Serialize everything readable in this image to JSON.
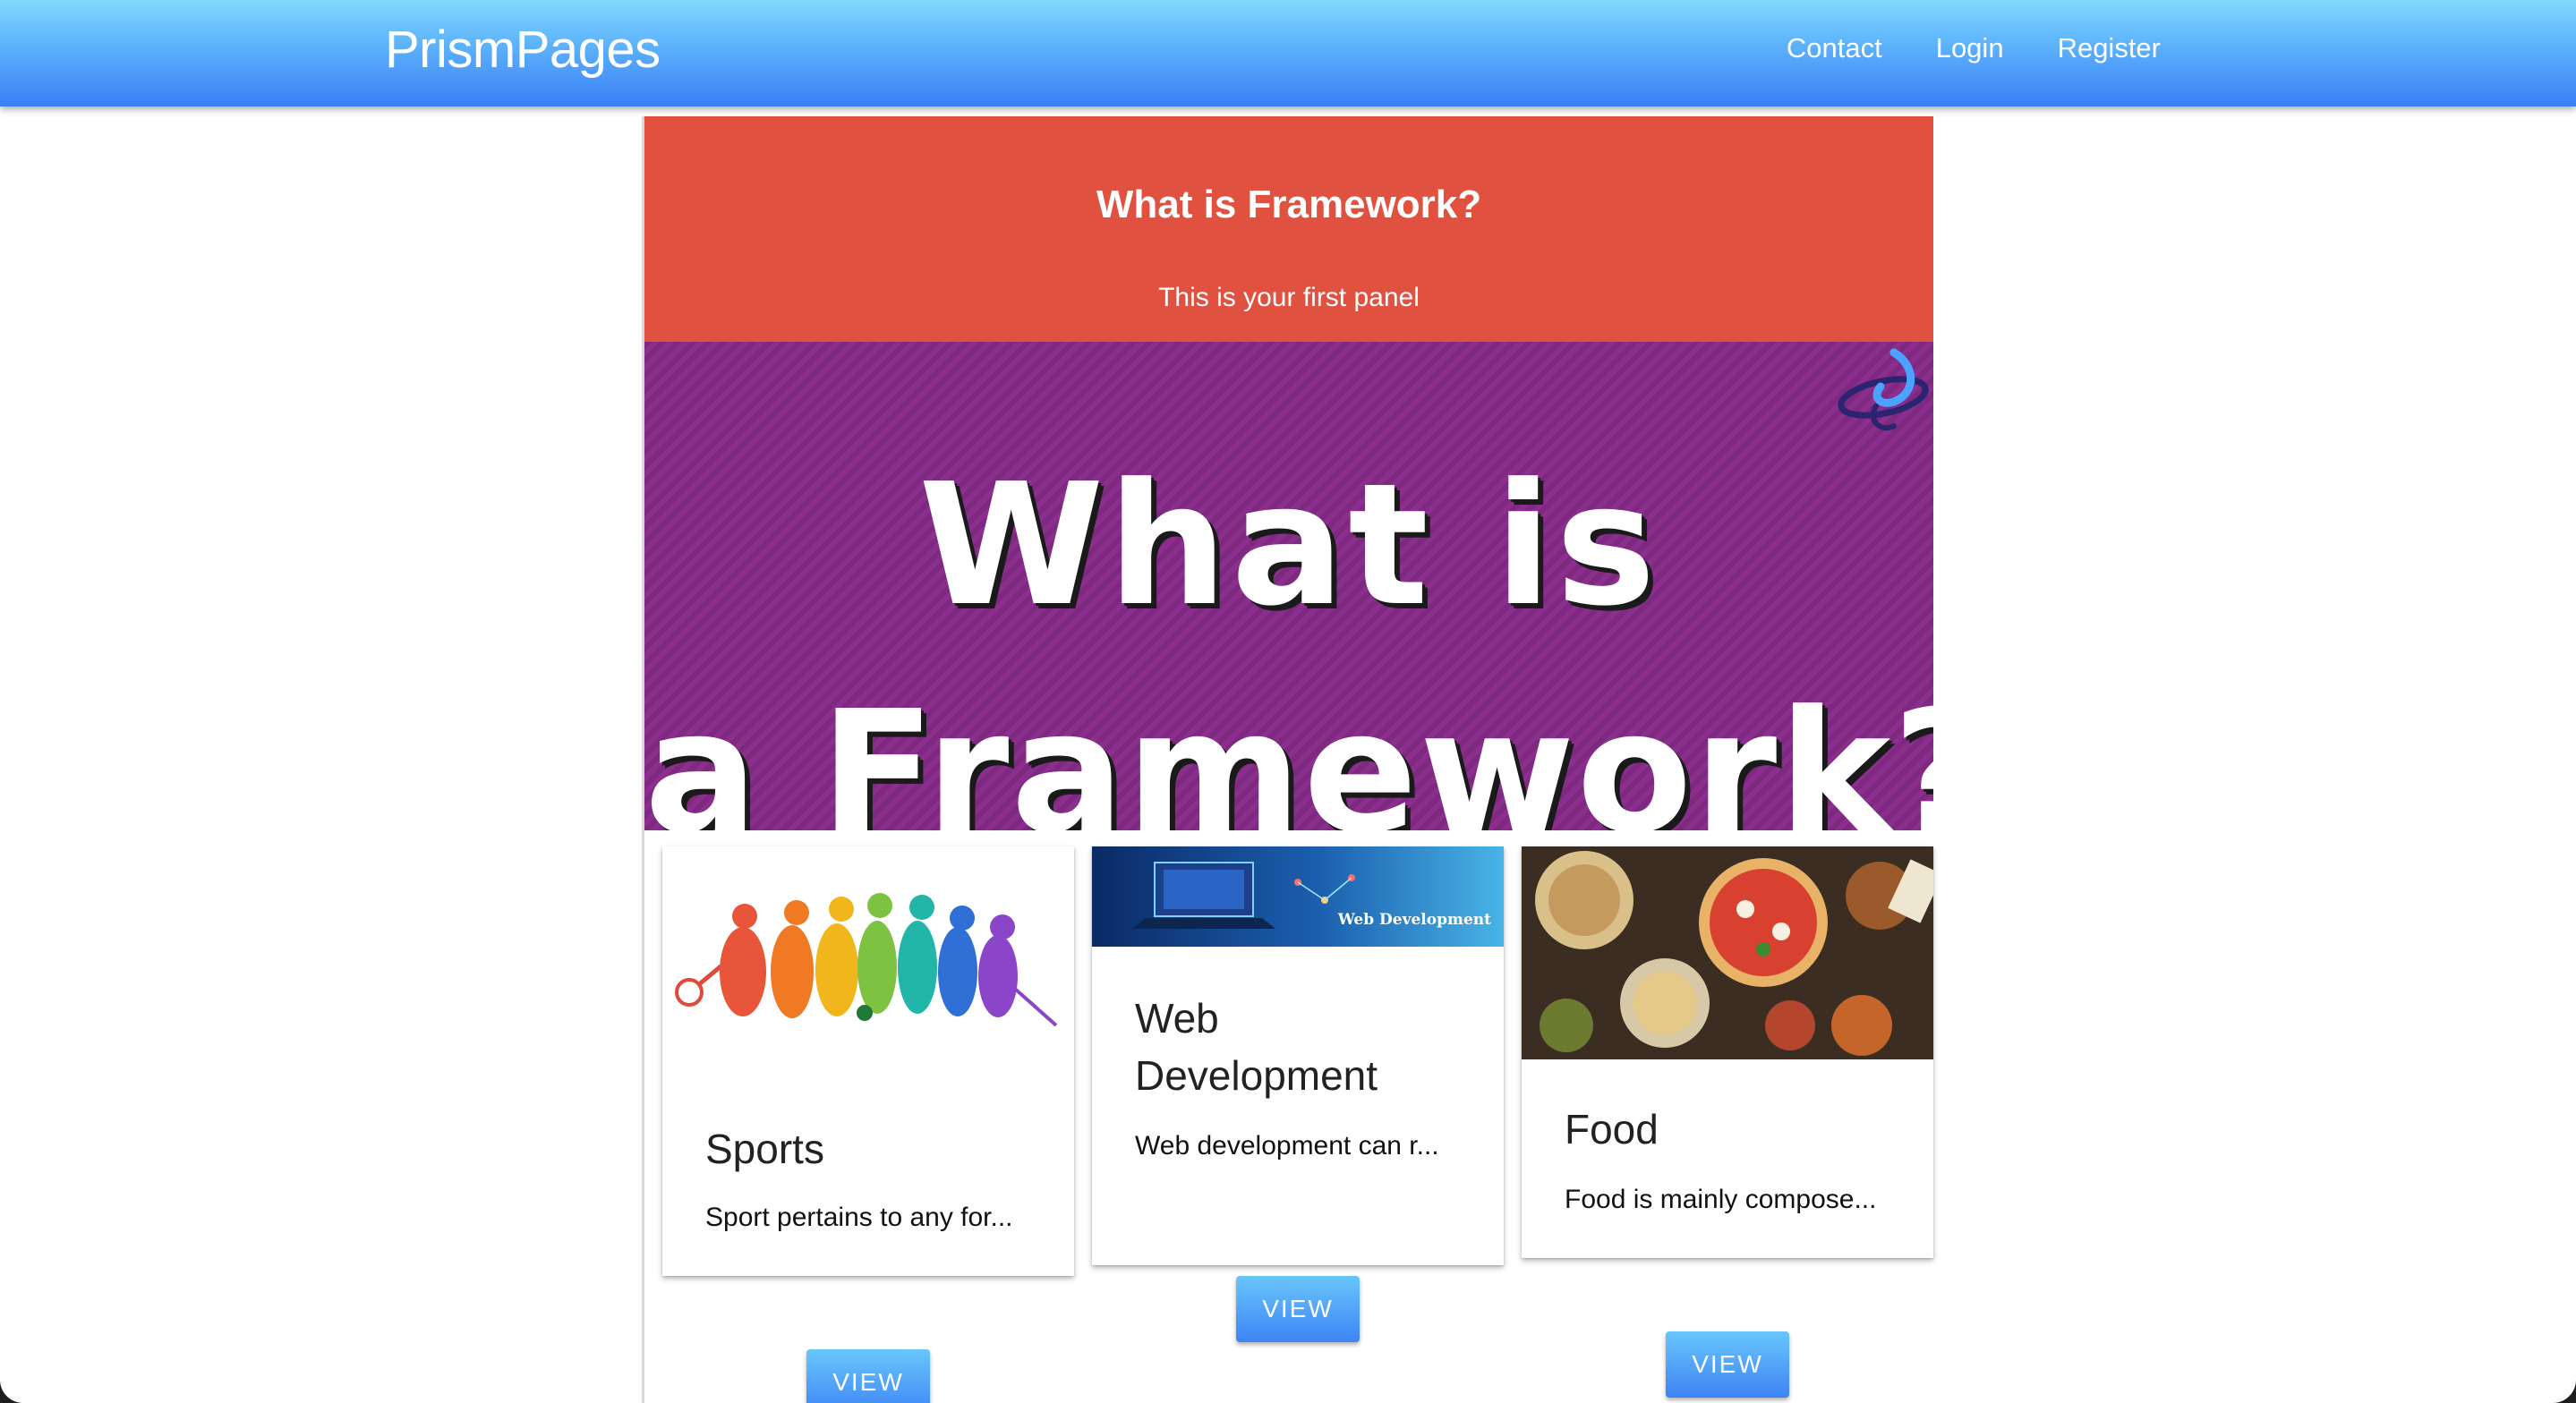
{
  "navbar": {
    "brand": "PrismPages",
    "links": [
      "Contact",
      "Login",
      "Register"
    ]
  },
  "panel": {
    "title": "What is Framework?",
    "subtitle": "This is your first panel"
  },
  "hero": {
    "line1": "What is",
    "line2": "a Framework?"
  },
  "cards": [
    {
      "title": "Sports",
      "text": "Sport pertains to any for...",
      "button": "VIEW"
    },
    {
      "title_line1": "Web",
      "title_line2": "Development",
      "text": "Web development can r...",
      "button": "VIEW",
      "image_caption": "Web Development"
    },
    {
      "title": "Food",
      "text": "Food is mainly compose...",
      "button": "VIEW"
    }
  ],
  "colors": {
    "navbar_top": "#80d9fd",
    "navbar_bottom": "#3a7ef6",
    "panel": "#e05140",
    "hero": "#8b2e8e",
    "button": "#3d84f5"
  }
}
